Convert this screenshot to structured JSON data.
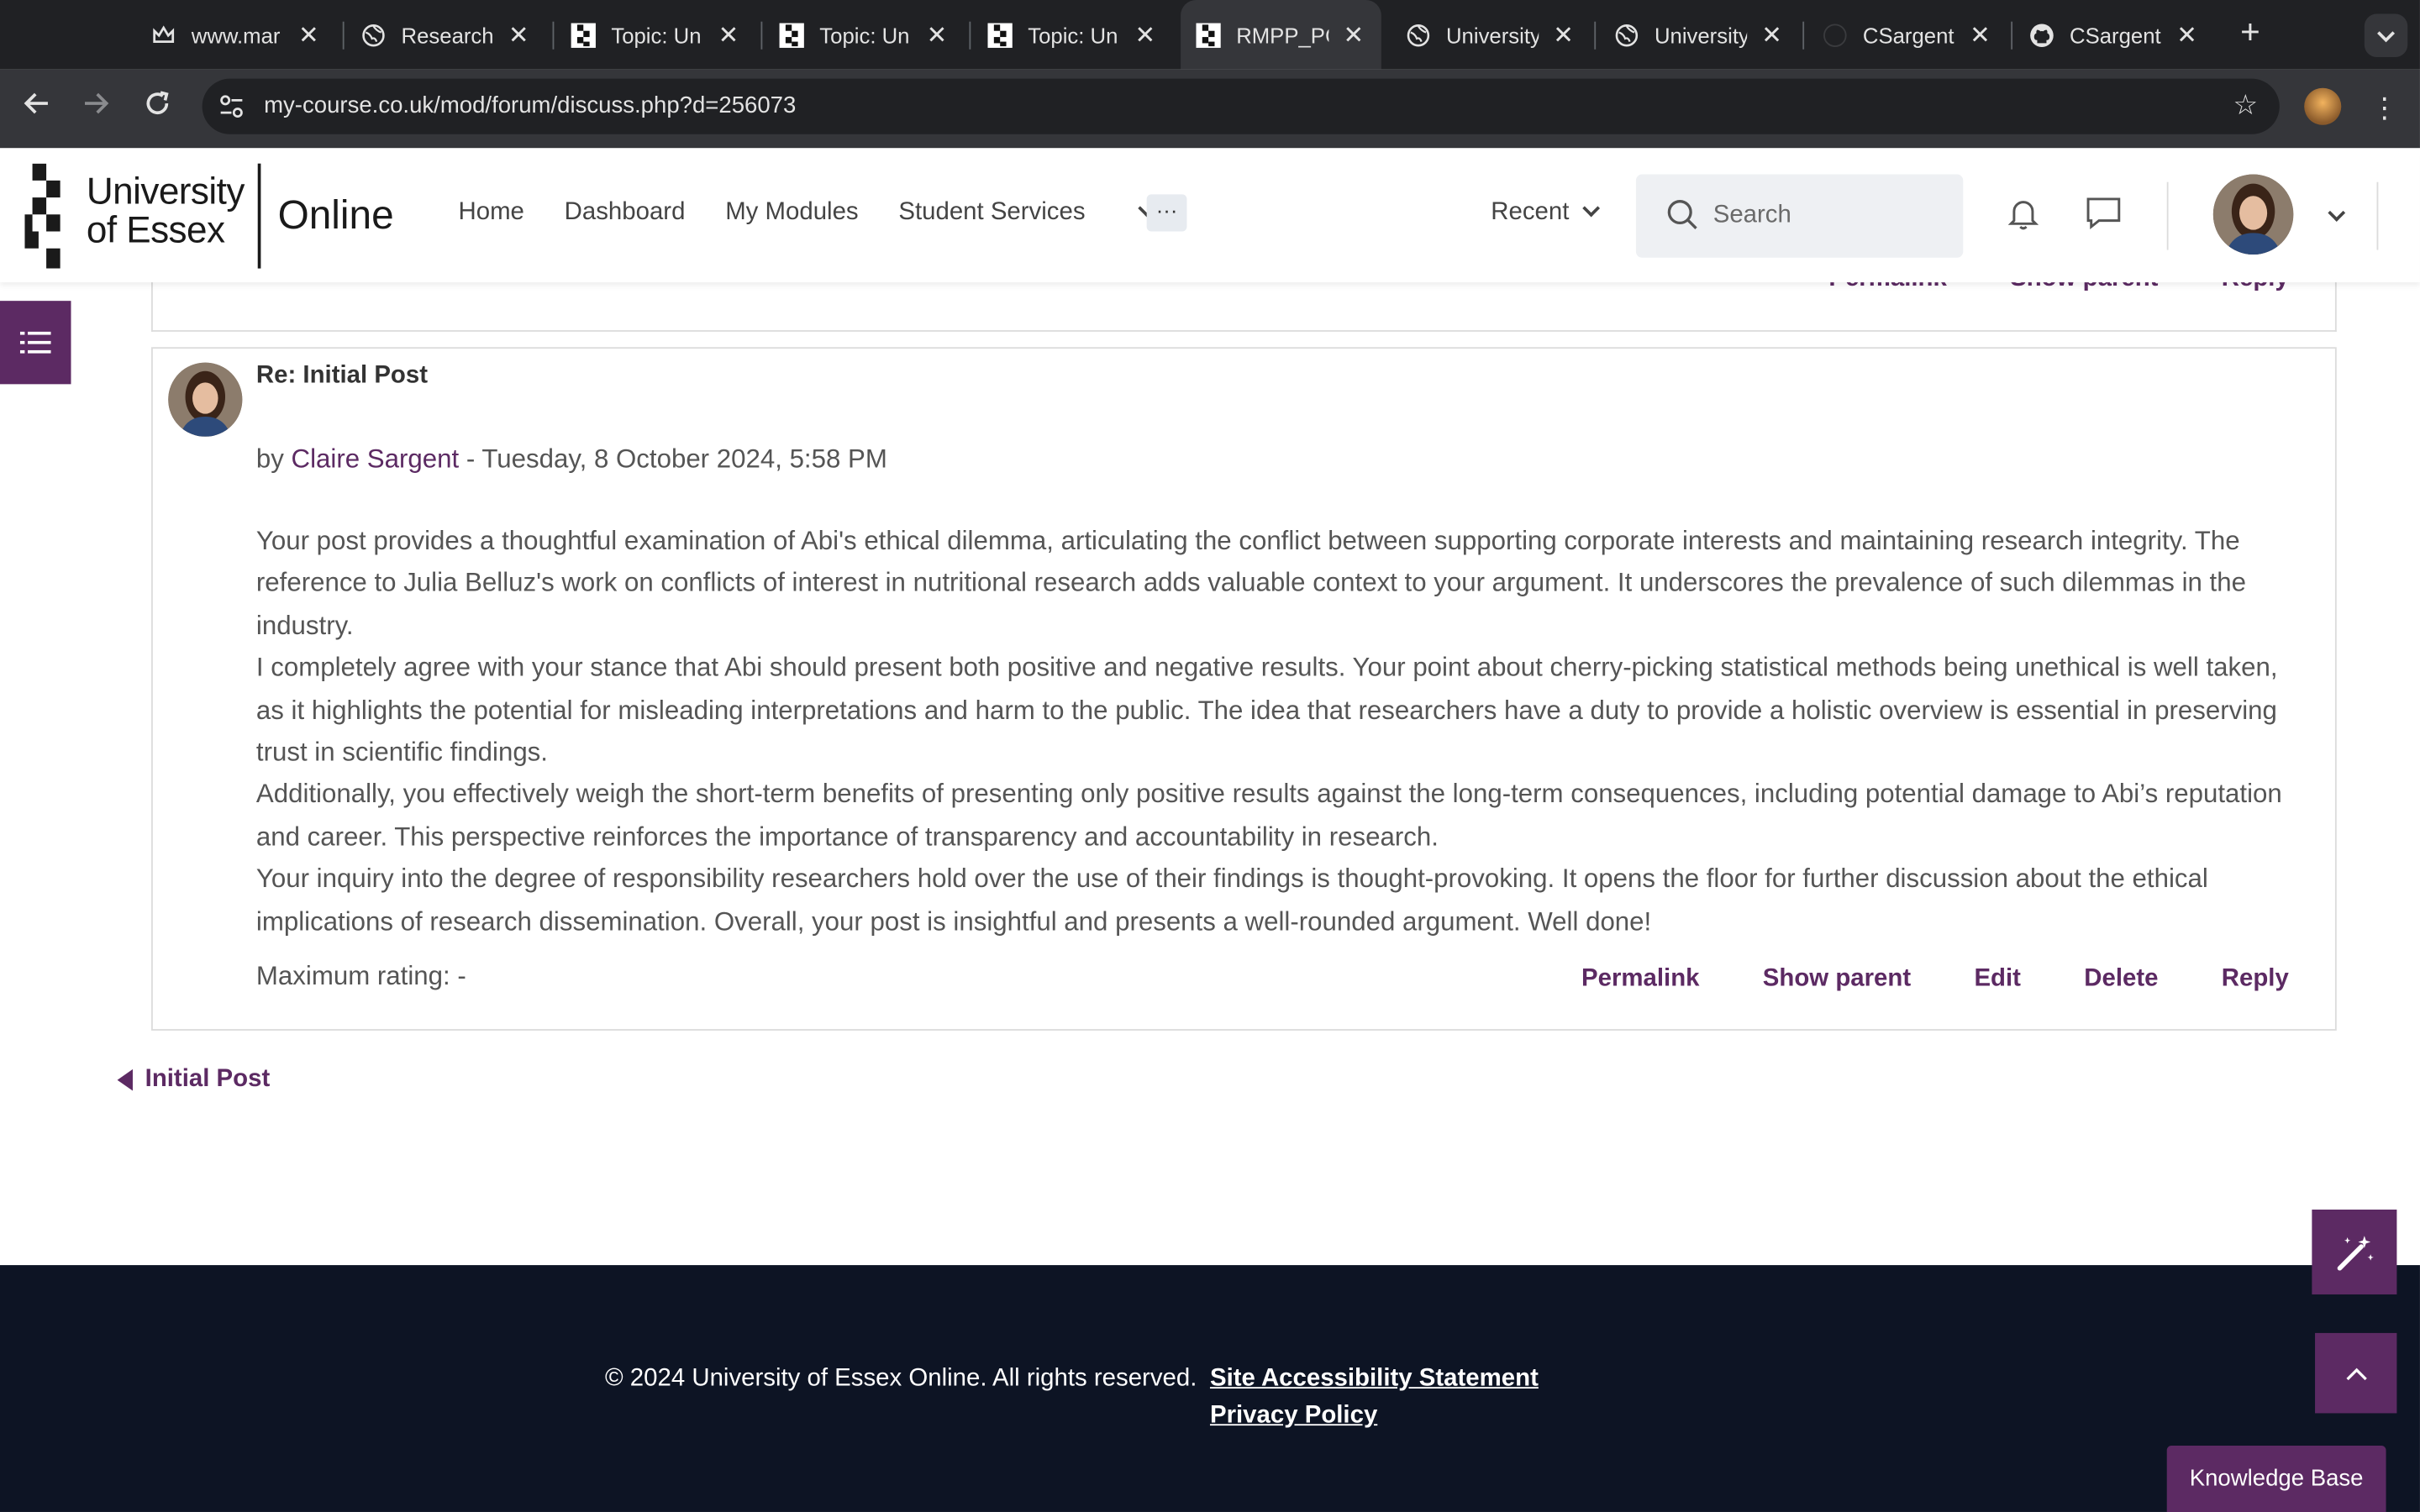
{
  "browser": {
    "tabs": [
      {
        "title": "www.mar",
        "icon": "crown-icon",
        "active": false
      },
      {
        "title": "Research",
        "icon": "globe-icon",
        "active": false
      },
      {
        "title": "Topic: Un",
        "icon": "essex-icon",
        "active": false
      },
      {
        "title": "Topic: Un",
        "icon": "essex-icon",
        "active": false
      },
      {
        "title": "Topic: Un",
        "icon": "essex-icon",
        "active": false
      },
      {
        "title": "RMPP_PC",
        "icon": "essex-icon",
        "active": true
      },
      {
        "title": "University",
        "icon": "globe-icon",
        "active": false
      },
      {
        "title": "University",
        "icon": "globe-icon",
        "active": false
      },
      {
        "title": "CSargent",
        "icon": "github-icon",
        "active": false
      },
      {
        "title": "CSargent",
        "icon": "github-icon",
        "active": false
      }
    ],
    "url": "my-course.co.uk/mod/forum/discuss.php?d=256073"
  },
  "header": {
    "logo_line1": "University",
    "logo_line2": "of Essex",
    "logo_online": "Online",
    "nav": [
      "Home",
      "Dashboard",
      "My Modules",
      "Student Services"
    ],
    "more": "···",
    "recent": "Recent",
    "search_placeholder": "Search"
  },
  "prev_post": {
    "actions": [
      "Permalink",
      "Show parent",
      "Reply"
    ]
  },
  "post": {
    "subject": "Re: Initial Post",
    "by": "by ",
    "author": "Claire Sargent",
    "date": " - Tuesday, 8 October 2024, 5:58 PM",
    "paragraphs": [
      "Your post provides a thoughtful examination of Abi's ethical dilemma, articulating the conflict between supporting corporate interests and maintaining research integrity. The reference to Julia Belluz's work on conflicts of interest in nutritional research adds valuable context to your argument. It underscores the prevalence of such dilemmas in the industry.",
      "I completely agree with your stance that Abi should present both positive and negative results. Your point about cherry-picking statistical methods being unethical is well taken, as it highlights the potential for misleading interpretations and harm to the public. The idea that researchers have a duty to provide a holistic overview is essential in preserving trust in scientific findings.",
      "Additionally, you effectively weigh the short-term benefits of presenting only positive results against the long-term consequences, including potential damage to Abi’s reputation and career. This perspective reinforces the importance of transparency and accountability in research.",
      "Your inquiry into the degree of responsibility researchers hold over the use of their findings is thought-provoking. It opens the floor for further discussion about the ethical implications of research dissemination. Overall, your post is insightful and presents a well-rounded argument. Well done!"
    ],
    "rating": "Maximum rating: -",
    "actions": [
      "Permalink",
      "Show parent",
      "Edit",
      "Delete",
      "Reply"
    ]
  },
  "prev_link": "Initial Post",
  "footer": {
    "copyright": "© 2024 University of Essex Online. All rights reserved.",
    "accessibility": "Site Accessibility Statement",
    "privacy": "Privacy Policy"
  },
  "knowledge_base": "Knowledge Base",
  "colors": {
    "brand_purple": "#5c2a63",
    "footer_bg": "#0d1424"
  }
}
